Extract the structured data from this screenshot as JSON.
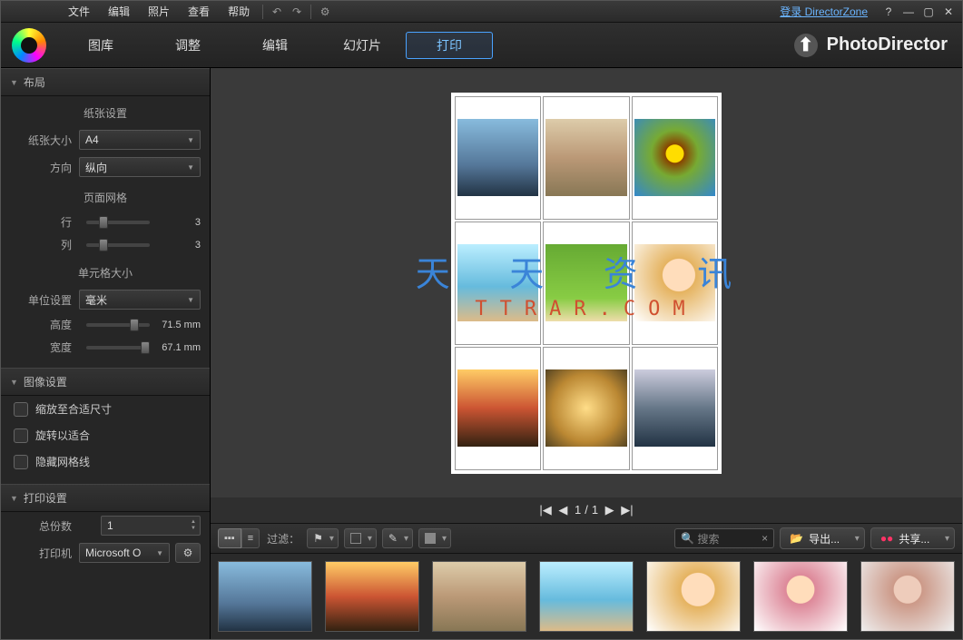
{
  "menu": {
    "file": "文件",
    "edit": "编辑",
    "photo": "照片",
    "view": "查看",
    "help": "帮助",
    "login": "登录 DirectorZone"
  },
  "brand": "PhotoDirector",
  "tabs": {
    "library": "图库",
    "adjust": "调整",
    "edit_tab": "编辑",
    "slideshow": "幻灯片",
    "print": "打印"
  },
  "sidebar": {
    "layout_panel": "布局",
    "paper_section": "纸张设置",
    "paper_size_label": "纸张大小",
    "paper_size_value": "A4",
    "orientation_label": "方向",
    "orientation_value": "纵向",
    "grid_section": "页面网格",
    "rows_label": "行",
    "rows_value": "3",
    "cols_label": "列",
    "cols_value": "3",
    "cell_section": "单元格大小",
    "unit_label": "单位设置",
    "unit_value": "毫米",
    "height_label": "高度",
    "height_value": "71.5 mm",
    "width_label": "宽度",
    "width_value": "67.1 mm",
    "image_panel": "图像设置",
    "fit_checkbox": "缩放至合适尺寸",
    "rotate_checkbox": "旋转以适合",
    "hide_grid_checkbox": "隐藏网格线",
    "print_panel": "打印设置",
    "copies_label": "总份数",
    "copies_value": "1",
    "printer_label": "打印机",
    "printer_value": "Microsoft O"
  },
  "pager": {
    "current": "1",
    "separator": "/",
    "total": "1"
  },
  "bottombar": {
    "filter_label": "过滤：",
    "search_placeholder": "搜索",
    "export": "导出...",
    "share": "共享..."
  },
  "watermark": {
    "cn": "天 天 资 讯",
    "en": "TTRAR.COM"
  }
}
